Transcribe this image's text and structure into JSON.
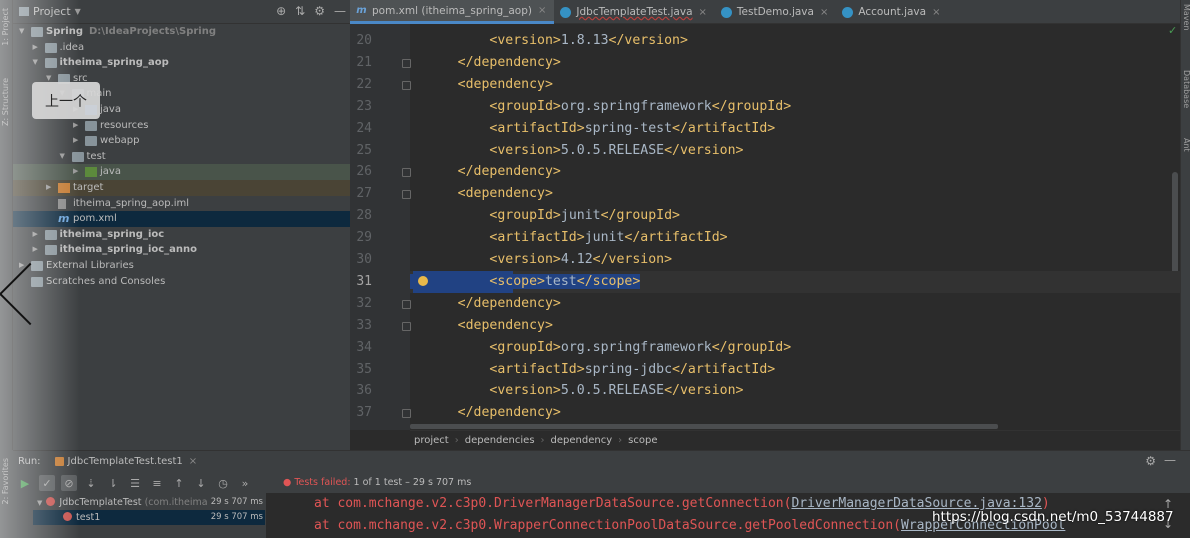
{
  "side_tabs": {
    "project": "1: Project",
    "structure": "Z: Structure",
    "favorites": "2: Favorites"
  },
  "project_panel": {
    "title": "Project",
    "tree": [
      {
        "label": "Spring",
        "sub": "D:\\IdeaProjects\\Spring",
        "depth": 0,
        "expanded": true,
        "bold": true,
        "icon": "folder"
      },
      {
        "label": ".idea",
        "depth": 1,
        "expanded": false,
        "icon": "folder"
      },
      {
        "label": "itheima_spring_aop",
        "depth": 1,
        "expanded": true,
        "bold": true,
        "icon": "module-folder"
      },
      {
        "label": "src",
        "depth": 2,
        "expanded": true,
        "icon": "folder"
      },
      {
        "label": "main",
        "depth": 3,
        "expanded": true,
        "icon": "folder"
      },
      {
        "label": "java",
        "depth": 4,
        "expanded": false,
        "icon": "source-folder"
      },
      {
        "label": "resources",
        "depth": 4,
        "expanded": false,
        "icon": "folder"
      },
      {
        "label": "webapp",
        "depth": 4,
        "expanded": false,
        "icon": "folder"
      },
      {
        "label": "test",
        "depth": 3,
        "expanded": true,
        "icon": "folder"
      },
      {
        "label": "java",
        "depth": 4,
        "expanded": false,
        "icon": "test-folder",
        "highlight": "green"
      },
      {
        "label": "target",
        "depth": 2,
        "expanded": false,
        "icon": "excluded-folder",
        "highlight": "orange"
      },
      {
        "label": "itheima_spring_aop.iml",
        "depth": 2,
        "icon": "file"
      },
      {
        "label": "pom.xml",
        "depth": 2,
        "icon": "maven-file",
        "selected": true
      },
      {
        "label": "itheima_spring_ioc",
        "depth": 1,
        "expanded": false,
        "bold": true,
        "icon": "module-folder"
      },
      {
        "label": "itheima_spring_ioc_anno",
        "depth": 1,
        "expanded": false,
        "bold": true,
        "icon": "module-folder"
      },
      {
        "label": "External Libraries",
        "depth": 0,
        "expanded": false,
        "icon": "library"
      },
      {
        "label": "Scratches and Consoles",
        "depth": 0,
        "icon": "scratches"
      }
    ]
  },
  "overlay": {
    "tooltip": "上一个"
  },
  "editor": {
    "tabs": [
      {
        "label": "pom.xml (itheima_spring_aop)",
        "icon": "m",
        "active": true
      },
      {
        "label": "JdbcTemplateTest.java",
        "icon": "test-class",
        "error": true
      },
      {
        "label": "TestDemo.java",
        "icon": "test-class"
      },
      {
        "label": "Account.java",
        "icon": "class"
      }
    ],
    "lines": [
      {
        "n": "20",
        "indent": 2,
        "parts": [
          [
            "tag",
            "<version>"
          ],
          [
            "txt",
            "1.8.13"
          ],
          [
            "tag",
            "</version>"
          ]
        ]
      },
      {
        "n": "21",
        "indent": 1,
        "parts": [
          [
            "tag",
            "</dependency>"
          ]
        ]
      },
      {
        "n": "22",
        "indent": 1,
        "parts": [
          [
            "tag",
            "<dependency>"
          ]
        ]
      },
      {
        "n": "23",
        "indent": 2,
        "parts": [
          [
            "tag",
            "<groupId>"
          ],
          [
            "txt",
            "org.springframework"
          ],
          [
            "tag",
            "</groupId>"
          ]
        ]
      },
      {
        "n": "24",
        "indent": 2,
        "parts": [
          [
            "tag",
            "<artifactId>"
          ],
          [
            "txt",
            "spring-test"
          ],
          [
            "tag",
            "</artifactId>"
          ]
        ]
      },
      {
        "n": "25",
        "indent": 2,
        "parts": [
          [
            "tag",
            "<version>"
          ],
          [
            "txt",
            "5.0.5.RELEASE"
          ],
          [
            "tag",
            "</version>"
          ]
        ]
      },
      {
        "n": "26",
        "indent": 1,
        "parts": [
          [
            "tag",
            "</dependency>"
          ]
        ]
      },
      {
        "n": "27",
        "indent": 1,
        "parts": [
          [
            "tag",
            "<dependency>"
          ]
        ]
      },
      {
        "n": "28",
        "indent": 2,
        "parts": [
          [
            "tag",
            "<groupId>"
          ],
          [
            "txt",
            "junit"
          ],
          [
            "tag",
            "</groupId>"
          ]
        ]
      },
      {
        "n": "29",
        "indent": 2,
        "parts": [
          [
            "tag",
            "<artifactId>"
          ],
          [
            "txt",
            "junit"
          ],
          [
            "tag",
            "</artifactId>"
          ]
        ]
      },
      {
        "n": "30",
        "indent": 2,
        "parts": [
          [
            "tag",
            "<version>"
          ],
          [
            "txt",
            "4.12"
          ],
          [
            "tag",
            "</version>"
          ]
        ]
      },
      {
        "n": "31",
        "indent": 2,
        "current": true,
        "parts": [
          [
            "tag",
            "<scope>"
          ],
          [
            "txt",
            "test"
          ],
          [
            "tag",
            "</scope>"
          ]
        ]
      },
      {
        "n": "32",
        "indent": 1,
        "parts": [
          [
            "tag",
            "</dependency>"
          ]
        ]
      },
      {
        "n": "33",
        "indent": 1,
        "parts": [
          [
            "tag",
            "<dependency>"
          ]
        ]
      },
      {
        "n": "34",
        "indent": 2,
        "parts": [
          [
            "tag",
            "<groupId>"
          ],
          [
            "txt",
            "org.springframework"
          ],
          [
            "tag",
            "</groupId>"
          ]
        ]
      },
      {
        "n": "35",
        "indent": 2,
        "parts": [
          [
            "tag",
            "<artifactId>"
          ],
          [
            "txt",
            "spring-jdbc"
          ],
          [
            "tag",
            "</artifactId>"
          ]
        ]
      },
      {
        "n": "36",
        "indent": 2,
        "parts": [
          [
            "tag",
            "<version>"
          ],
          [
            "txt",
            "5.0.5.RELEASE"
          ],
          [
            "tag",
            "</version>"
          ]
        ]
      },
      {
        "n": "37",
        "indent": 1,
        "parts": [
          [
            "tag",
            "</dependency>"
          ]
        ]
      }
    ],
    "breadcrumb": [
      "project",
      "dependencies",
      "dependency",
      "scope"
    ]
  },
  "right_tabs": {
    "maven": "Maven",
    "database": "Database",
    "ant": "Ant"
  },
  "run_panel": {
    "label": "Run:",
    "tab": "JdbcTemplateTest.test1",
    "status_prefix": "Tests failed:",
    "status_rest": " 1 of 1 test – 29 s 707 ms",
    "tests": [
      {
        "name": "JdbcTemplateTest",
        "pkg": "(com.itheima",
        "time": "29 s 707 ms"
      },
      {
        "name": "test1",
        "time": "29 s 707 ms",
        "selected": true
      }
    ],
    "console": [
      {
        "prefix": "at com.mchange.v2.c3p0.DriverManagerDataSource.getConnection(",
        "link": "DriverManagerDataSource.java:132",
        "suffix": ")"
      },
      {
        "prefix": "at com.mchange.v2.c3p0.WrapperConnectionPoolDataSource.getPooledConnection(",
        "link": "WrapperConnectionPool",
        "suffix": ""
      }
    ]
  },
  "watermark": "https://blog.csdn.net/m0_53744887",
  "colors": {
    "tag": "#e8bf6a",
    "text": "#a9b7c6",
    "selection": "#214283",
    "error": "#e05555"
  }
}
